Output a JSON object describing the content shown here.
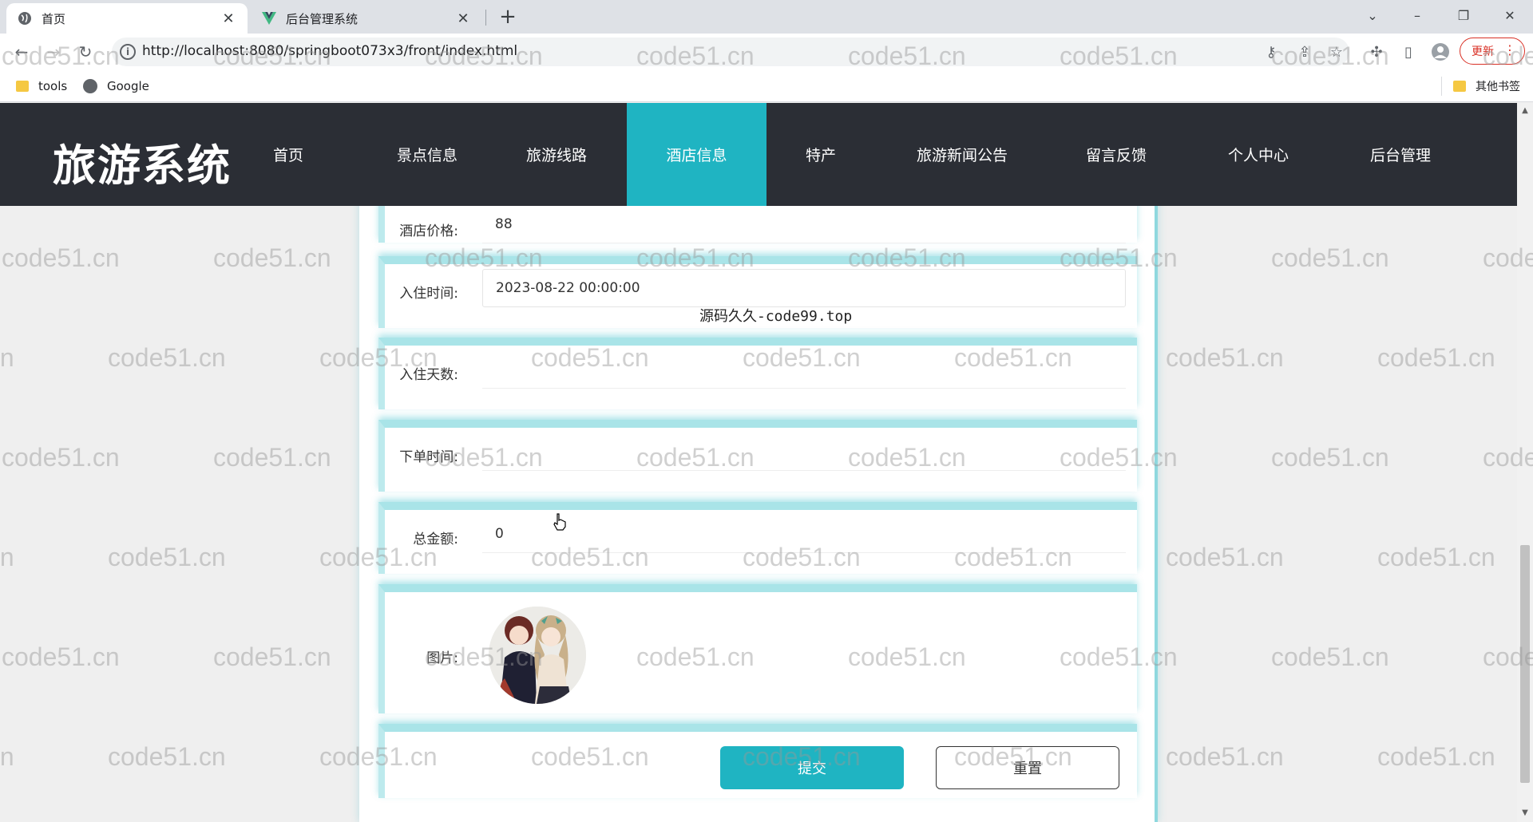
{
  "browser": {
    "tabs": [
      {
        "title": "首页",
        "icon": "globe-icon",
        "active": true
      },
      {
        "title": "后台管理系统",
        "icon": "vue-logo-icon",
        "active": false
      }
    ],
    "url": "http://localhost:8080/springboot073x3/front/index.html",
    "update_label": "更新",
    "bookmarks": [
      {
        "label": "tools",
        "icon": "folder-icon"
      },
      {
        "label": "Google",
        "icon": "globe-icon"
      }
    ],
    "other_bookmarks": "其他书签"
  },
  "site": {
    "logo": "旅游系统",
    "nav": [
      "首页",
      "景点信息",
      "旅游线路",
      "酒店信息",
      "特产",
      "旅游新闻公告",
      "留言反馈",
      "个人中心",
      "后台管理"
    ],
    "active_nav": "酒店信息",
    "accent_color": "#1fb4c2"
  },
  "form": {
    "price": {
      "label": "酒店价格:",
      "value": "88"
    },
    "checkin_time": {
      "label": "入住时间:",
      "value": "2023-08-22 00:00:00"
    },
    "days": {
      "label": "入住天数:",
      "value": ""
    },
    "order_time": {
      "label": "下单时间:",
      "value": ""
    },
    "total": {
      "label": "总金额:",
      "value": "0"
    },
    "image": {
      "label": "图片:"
    },
    "submit_label": "提交",
    "reset_label": "重置"
  },
  "overlay_text": "源码久久-code99.top",
  "watermark_text": "code51.cn"
}
